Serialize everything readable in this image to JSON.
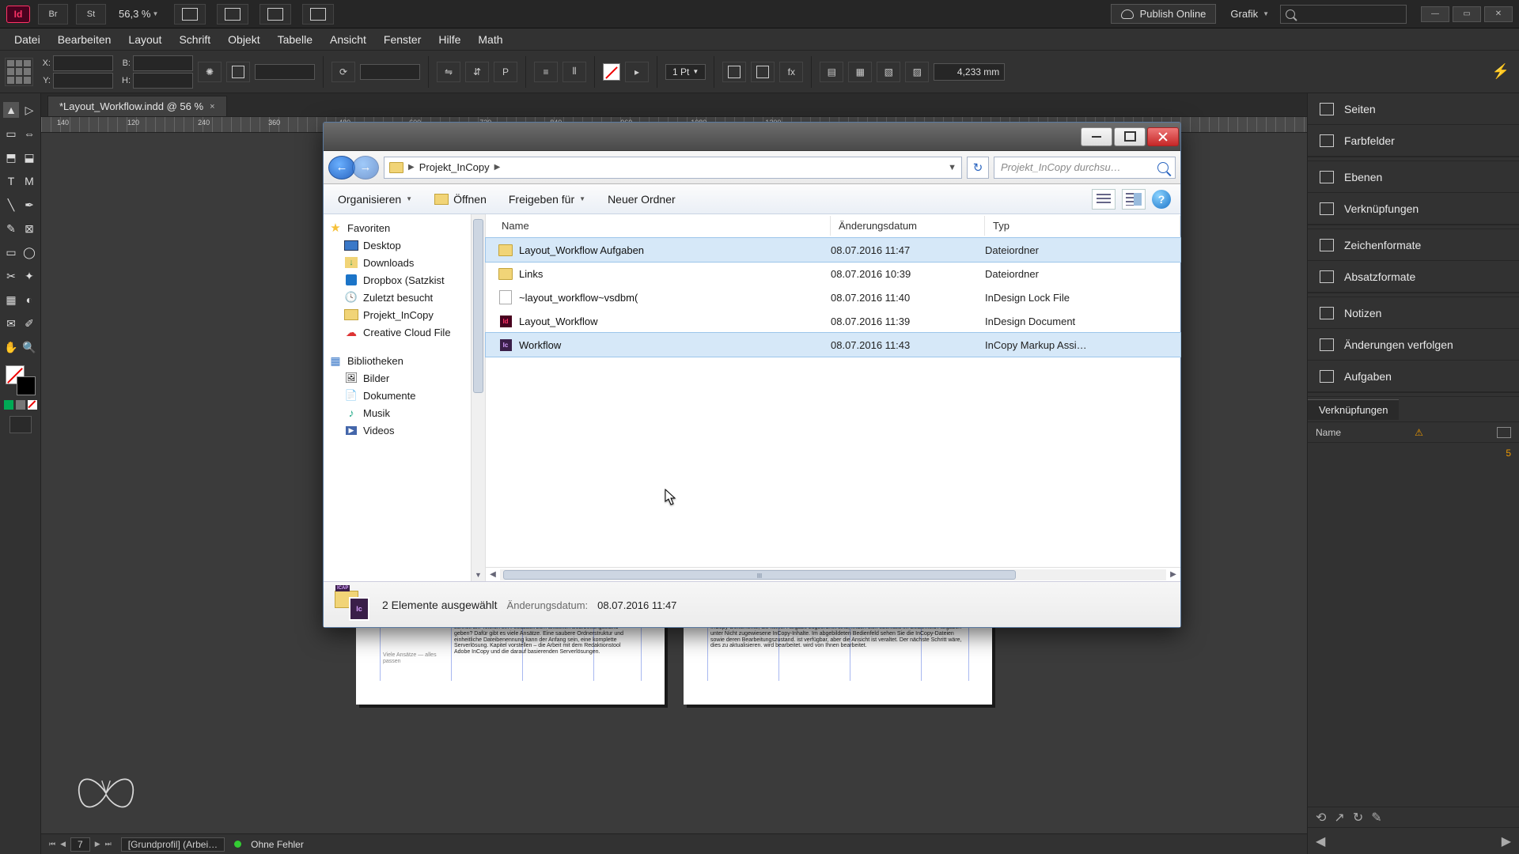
{
  "titlebar": {
    "zoom": "56,3 %",
    "publish": "Publish Online",
    "essentials": "Grafik"
  },
  "menu": [
    "Datei",
    "Bearbeiten",
    "Layout",
    "Schrift",
    "Objekt",
    "Tabelle",
    "Ansicht",
    "Fenster",
    "Hilfe",
    "Math"
  ],
  "control": {
    "xlab": "X:",
    "ylab": "Y:",
    "wlab": "B:",
    "hlab": "H:",
    "stroke_weight": "1 Pt",
    "value": "4,233 mm"
  },
  "doc_tab": {
    "title": "*Layout_Workflow.indd @ 56 %",
    "close": "×"
  },
  "ruler_marks": [
    "140",
    "120",
    "240",
    "360",
    "480",
    "600",
    "720",
    "840",
    "960",
    "1080",
    "1200"
  ],
  "right_panels": {
    "items": [
      "Seiten",
      "Farbfelder",
      "Ebenen",
      "Verknüpfungen",
      "Zeichenformate",
      "Absatzformate",
      "Notizen",
      "Änderungen verfolgen",
      "Aufgaben"
    ],
    "links": {
      "tab": "Verknüpfungen",
      "col_name": "Name",
      "row_page": "5"
    }
  },
  "status": {
    "page": "7",
    "profile": "[Grundprofil] (Arbei…",
    "errors": "Ohne Fehler"
  },
  "explorer": {
    "path_segment": "Projekt_InCopy",
    "search_placeholder": "Projekt_InCopy durchsu…",
    "toolbar": {
      "organize": "Organisieren",
      "open": "Öffnen",
      "share": "Freigeben für",
      "newfolder": "Neuer Ordner",
      "help": "?"
    },
    "tree": {
      "favorites": "Favoriten",
      "items_fav": [
        {
          "icon": "desk",
          "label": "Desktop"
        },
        {
          "icon": "dl",
          "label": "Downloads"
        },
        {
          "icon": "db",
          "label": "Dropbox (Satzkist"
        },
        {
          "icon": "rec",
          "label": "Zuletzt besucht"
        },
        {
          "icon": "fold",
          "label": "Projekt_InCopy"
        },
        {
          "icon": "cc",
          "label": "Creative Cloud File"
        }
      ],
      "libraries": "Bibliotheken",
      "items_lib": [
        {
          "icon": "pic",
          "label": "Bilder"
        },
        {
          "icon": "doc",
          "label": "Dokumente"
        },
        {
          "icon": "mus",
          "label": "Musik"
        },
        {
          "icon": "vid",
          "label": "Videos"
        }
      ]
    },
    "columns": {
      "name": "Name",
      "date": "Änderungsdatum",
      "type": "Typ"
    },
    "rows": [
      {
        "sel": true,
        "icon": "fold",
        "name": "Layout_Workflow Aufgaben",
        "date": "08.07.2016 11:47",
        "type": "Dateiordner"
      },
      {
        "sel": false,
        "icon": "fold",
        "name": "Links",
        "date": "08.07.2016 10:39",
        "type": "Dateiordner"
      },
      {
        "sel": false,
        "icon": "idlk",
        "name": "~layout_workflow~vsdbm(",
        "date": "08.07.2016 11:40",
        "type": "InDesign Lock File"
      },
      {
        "sel": false,
        "icon": "indd",
        "name": "Layout_Workflow",
        "date": "08.07.2016 11:39",
        "type": "InDesign Document"
      },
      {
        "sel": true,
        "icon": "icma",
        "name": "Workflow",
        "date": "08.07.2016 11:43",
        "type": "InCopy Markup Assi…"
      }
    ],
    "details": {
      "main": "2 Elemente ausgewählt",
      "date_key": "Änderungsdatum:",
      "date_val": "08.07.2016 11:47"
    }
  },
  "colors": {
    "accent": "#2a65c0",
    "explorer_sel": "#d6e8f8",
    "id_brand": "#49021f"
  }
}
